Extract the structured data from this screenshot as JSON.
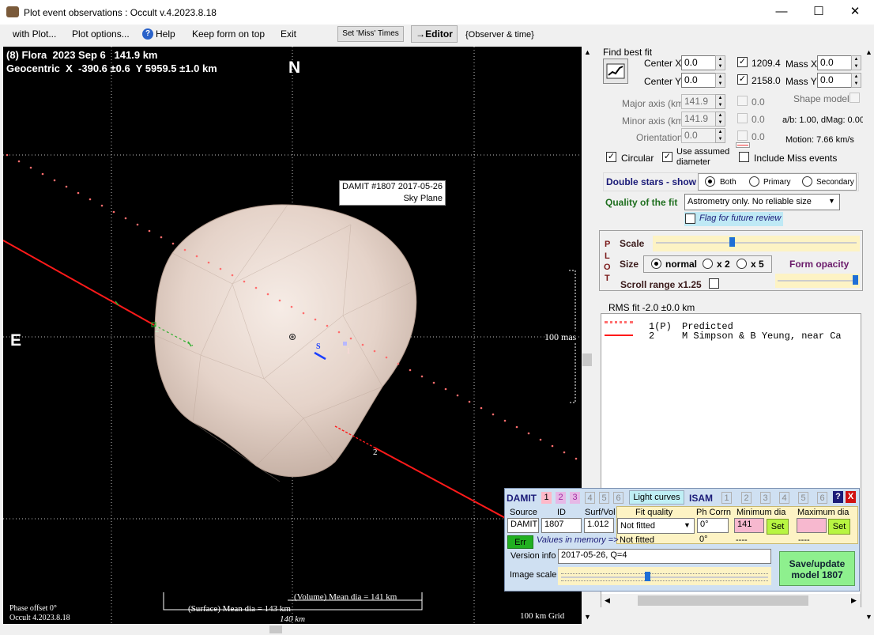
{
  "window": {
    "title": "Plot event observations : Occult v.4.2023.8.18",
    "controls": [
      "—",
      "☐",
      "✕"
    ]
  },
  "menu": {
    "with_plot": "with Plot...",
    "plot_options": "Plot options...",
    "help": "Help",
    "keep_form_on_top": "Keep form on top",
    "exit": "Exit",
    "set_miss_times": "Set 'Miss' Times",
    "editor": "→Editor",
    "observer_time": "{Observer & time}"
  },
  "plot": {
    "title_line1": "(8) Flora  2023 Sep 6   141.9 km",
    "title_line2": "Geocentric  X  -390.6 ±0.6  Y 5959.5 ±1.0 km",
    "north": "N",
    "east": "E",
    "model_label_line1": "DAMIT #1807 2017-05-26",
    "model_label_line2": "Sky Plane",
    "scale_label": "100 mas",
    "phase_offset": "Phase offset 0°",
    "version": "Occult 4.2023.8.18",
    "volume_dia": "(Volume) Mean dia = 141 km",
    "surface_dia": "(Surface) Mean dia = 143 km",
    "scale_km": "140 km",
    "grid": "100 km Grid",
    "chord_labels": {
      "pred": "1",
      "obs": "2",
      "s": "S"
    }
  },
  "fit": {
    "find_best_fit": "Find best fit",
    "center_x_label": "Center X",
    "center_x": "0.0",
    "center_y_label": "Center Y",
    "center_y": "0.0",
    "val_1209": "1209.4",
    "val_2158": "2158.0",
    "mass_x_label": "Mass X",
    "mass_x": "0.0",
    "mass_y_label": "Mass Y",
    "mass_y": "0.0",
    "major_axis_label": "Major axis (km)",
    "major_axis": "141.9",
    "minor_axis_label": "Minor axis (km)",
    "minor_axis": "141.9",
    "orientation_label": "Orientation",
    "orientation": "0.0",
    "major_side": "0.0",
    "minor_side": "0.0",
    "orient_side": "0.0",
    "shape_model": "Shape model",
    "ab_dmag": "a/b: 1.00, dMag: 0.00",
    "motion": "Motion: 7.66 km/s",
    "circular": "Circular",
    "use_assumed_1": "Use assumed",
    "use_assumed_2": "diameter",
    "include_miss": "Include Miss events",
    "double_stars": "Double stars - show",
    "both": "Both",
    "primary": "Primary",
    "secondary": "Secondary",
    "quality_label": "Quality of the fit",
    "quality_value": "Astrometry only. No reliable size",
    "flag_review": "Flag for future review"
  },
  "plot_settings": {
    "plot_letters": [
      "P",
      "L",
      "O",
      "T"
    ],
    "scale": "Scale",
    "size": "Size",
    "normal": "normal",
    "x2": "x 2",
    "x5": "x 5",
    "form_opacity": "Form opacity",
    "scroll_range": "Scroll range x1.25",
    "scale_level": 0.38,
    "opacity_level": 1.0
  },
  "rms": "RMS fit -2.0 ±0.0 km",
  "legend": [
    {
      "num": "1(P)",
      "text": "Predicted"
    },
    {
      "num": "2",
      "text": "M Simpson & B Yeung, near Ca"
    }
  ],
  "damit": {
    "damit": "DAMIT",
    "nums_left": [
      "1",
      "2",
      "3",
      "4",
      "5",
      "6"
    ],
    "light_curves": "Light curves",
    "isam": "ISAM",
    "nums_right": [
      "1",
      "2",
      "3",
      "4",
      "5",
      "6"
    ],
    "help_q": "?",
    "close_x": "X",
    "source_h": "Source",
    "id_h": "ID",
    "surfvol_h": "Surf/Vol",
    "fitq_h": "Fit quality",
    "phcorr_h": "Ph Corrn",
    "mindia_h": "Minimum dia",
    "maxdia_h": "Maximum dia",
    "source": "DAMIT",
    "id": "1807",
    "surfvol": "1.012",
    "fitq": "Not fitted",
    "phcorr": "0°",
    "mindia": "141",
    "set1": "Set",
    "maxdia": "",
    "set2": "Set",
    "err": "Err",
    "values_mem": "Values in memory =>",
    "fitq_mem": "Not fitted",
    "phcorr_mem": "0°",
    "mindia_mem": "----",
    "maxdia_mem": "----",
    "version_info_label": "Version info",
    "version_info": "2017-05-26, Q=4",
    "image_scale": "Image scale",
    "image_scale_level": 0.42,
    "save_line1": "Save/update",
    "save_line2": "model 1807"
  },
  "colors": {
    "asteroid": "#e8d6cc",
    "observed_chord": "#ff1a1a",
    "predicted_path": "#ff7a7a",
    "save_button": "#8ef08e",
    "damit_panel": "#cfe0f2"
  }
}
